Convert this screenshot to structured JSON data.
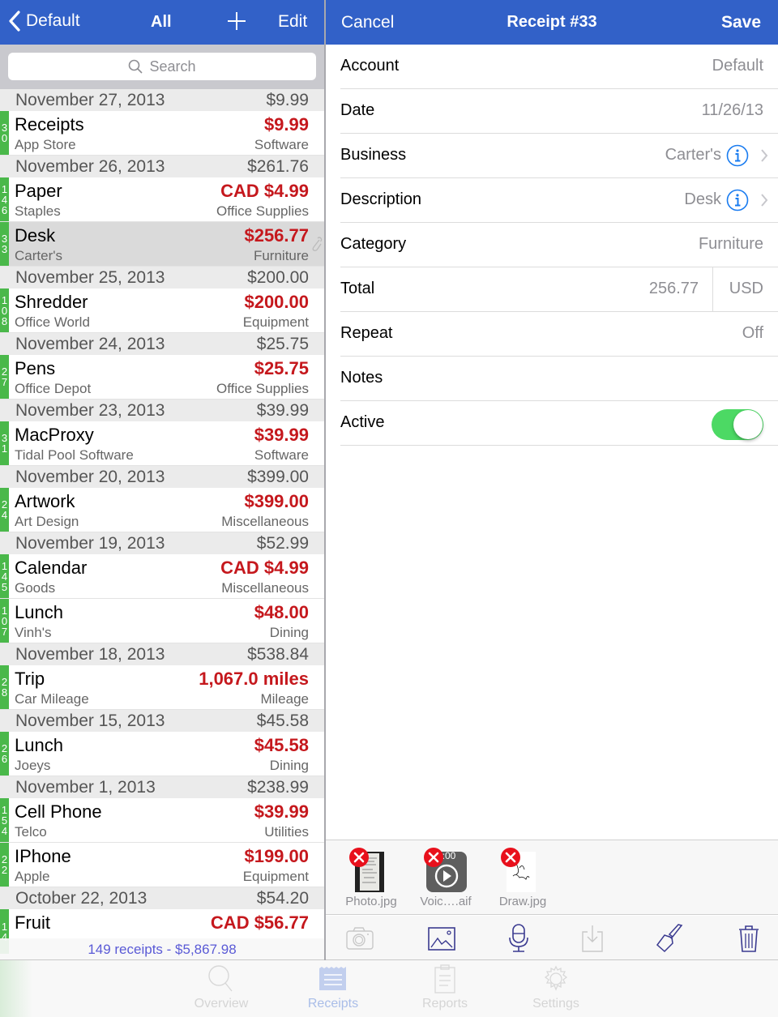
{
  "colors": {
    "nav_bar": "#3261c8",
    "amount_red": "#c5181d",
    "badge_green": "#4ab84a",
    "toggle_on": "#4cd964",
    "info_blue": "#1a7cf0",
    "summary_text": "#5a5ad6"
  },
  "left_nav": {
    "back_label": "Default",
    "back_icon": "chevron-left-icon",
    "title": "All",
    "add_icon": "plus-icon",
    "edit_label": "Edit"
  },
  "search": {
    "placeholder": "Search",
    "icon": "search-icon"
  },
  "receipt_groups": [
    {
      "date": "November 27, 2013",
      "total": "$9.99",
      "items": [
        {
          "badge": "30",
          "name": "Receipts",
          "amount": "$9.99",
          "vendor": "App Store",
          "category": "Software"
        }
      ]
    },
    {
      "date": "November 26, 2013",
      "total": "$261.76",
      "items": [
        {
          "badge": "146",
          "name": "Paper",
          "amount": "CAD $4.99",
          "vendor": "Staples",
          "category": "Office Supplies"
        },
        {
          "badge": "33",
          "name": "Desk",
          "amount": "$256.77",
          "vendor": "Carter's",
          "category": "Furniture",
          "selected": true,
          "attachment_icon": "paperclip-icon"
        }
      ]
    },
    {
      "date": "November 25, 2013",
      "total": "$200.00",
      "items": [
        {
          "badge": "108",
          "name": "Shredder",
          "amount": "$200.00",
          "vendor": "Office World",
          "category": "Equipment"
        }
      ]
    },
    {
      "date": "November 24, 2013",
      "total": "$25.75",
      "items": [
        {
          "badge": "27",
          "name": "Pens",
          "amount": "$25.75",
          "vendor": "Office Depot",
          "category": "Office Supplies"
        }
      ]
    },
    {
      "date": "November 23, 2013",
      "total": "$39.99",
      "items": [
        {
          "badge": "31",
          "name": "MacProxy",
          "amount": "$39.99",
          "vendor": "Tidal Pool Software",
          "category": "Software"
        }
      ]
    },
    {
      "date": "November 20, 2013",
      "total": "$399.00",
      "items": [
        {
          "badge": "24",
          "name": "Artwork",
          "amount": "$399.00",
          "vendor": "Art Design",
          "category": "Miscellaneous"
        }
      ]
    },
    {
      "date": "November 19, 2013",
      "total": "$52.99",
      "items": [
        {
          "badge": "145",
          "name": "Calendar",
          "amount": "CAD $4.99",
          "vendor": "Goods",
          "category": "Miscellaneous"
        },
        {
          "badge": "107",
          "name": "Lunch",
          "amount": "$48.00",
          "vendor": "Vinh's",
          "category": "Dining"
        }
      ]
    },
    {
      "date": "November 18, 2013",
      "total": "$538.84",
      "items": [
        {
          "badge": "28",
          "name": "Trip",
          "amount": "1,067.0 miles",
          "vendor": "Car Mileage",
          "category": "Mileage"
        }
      ]
    },
    {
      "date": "November 15, 2013",
      "total": "$45.58",
      "items": [
        {
          "badge": "26",
          "name": "Lunch",
          "amount": "$45.58",
          "vendor": "Joeys",
          "category": "Dining"
        }
      ]
    },
    {
      "date": "November 1, 2013",
      "total": "$238.99",
      "items": [
        {
          "badge": "154",
          "name": "Cell Phone",
          "amount": "$39.99",
          "vendor": "Telco",
          "category": "Utilities"
        },
        {
          "badge": "22",
          "name": "IPhone",
          "amount": "$199.00",
          "vendor": "Apple",
          "category": "Equipment"
        }
      ]
    },
    {
      "date": "October 22, 2013",
      "total": "$54.20",
      "items": [
        {
          "badge": "14",
          "name": "Fruit",
          "amount": "CAD $56.77",
          "vendor": "",
          "category": ""
        }
      ]
    }
  ],
  "summary": "149 receipts - $5,867.98",
  "right_nav": {
    "cancel_label": "Cancel",
    "title": "Receipt #33",
    "save_label": "Save"
  },
  "form": {
    "account": {
      "label": "Account",
      "value": "Default"
    },
    "date": {
      "label": "Date",
      "value": "11/26/13"
    },
    "business": {
      "label": "Business",
      "value": "Carter's"
    },
    "description": {
      "label": "Description",
      "value": "Desk"
    },
    "category": {
      "label": "Category",
      "value": "Furniture"
    },
    "total": {
      "label": "Total",
      "amount": "256.77",
      "currency": "USD"
    },
    "repeat": {
      "label": "Repeat",
      "value": "Off"
    },
    "notes": {
      "label": "Notes",
      "value": ""
    },
    "active": {
      "label": "Active",
      "on": true
    }
  },
  "attachments": [
    {
      "name": "Photo.jpg",
      "type": "photo"
    },
    {
      "name": "Voic….aif",
      "type": "audio",
      "duration": "0:00"
    },
    {
      "name": "Draw.jpg",
      "type": "drawing"
    }
  ],
  "toolbar": {
    "buttons": [
      {
        "icon": "camera-icon",
        "enabled": false
      },
      {
        "icon": "photo-library-icon",
        "enabled": true
      },
      {
        "icon": "microphone-icon",
        "enabled": true
      },
      {
        "icon": "import-icon",
        "enabled": false
      },
      {
        "icon": "paintbrush-icon",
        "enabled": true
      },
      {
        "icon": "trash-icon",
        "enabled": true
      }
    ]
  },
  "tabbar": {
    "tabs": [
      {
        "label": "Overview",
        "icon": "magnifier-icon",
        "active": false
      },
      {
        "label": "Receipts",
        "icon": "receipt-icon",
        "active": true
      },
      {
        "label": "Reports",
        "icon": "clipboard-icon",
        "active": false
      },
      {
        "label": "Settings",
        "icon": "gear-icon",
        "active": false
      }
    ]
  }
}
